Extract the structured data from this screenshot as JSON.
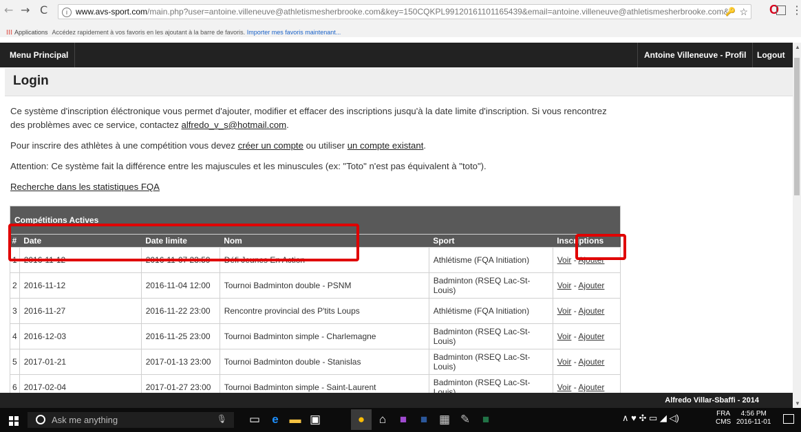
{
  "browser": {
    "url_host": "www.avs-sport.com",
    "url_rest": "/main.php?user=antoine.villeneuve@athletismesherbrooke.com&key=150CQKPL99120161101165439&email=antoine.villeneuve@athletismesherbrooke.com&",
    "bookmarks_apps": "Applications",
    "bookmarks_hint": "Accédez rapidement à vos favoris en les ajoutant à la barre de favoris.",
    "bookmarks_import": "Importer mes favoris maintenant..."
  },
  "nav": {
    "menu": "Menu Principal",
    "profile": "Antoine Villeneuve - Profil",
    "logout": "Logout"
  },
  "page": {
    "title": "Login",
    "p1_text": "Ce système d'inscription éléctronique vous permet d'ajouter, modifier et effacer des inscriptions jusqu'à la date limite d'inscription. Si vous rencontrez des problèmes avec ce service, contactez ",
    "p1_email": "alfredo_v_s@hotmail.com",
    "p1_end": ".",
    "p2_text": "Pour inscrire des athlètes à une compétition vous devez ",
    "p2_link1": "créer un compte",
    "p2_mid": " ou utiliser ",
    "p2_link2": "un compte existant",
    "p2_end": ".",
    "p3": "Attention: Ce système fait la différence entre les majuscules et les minuscules (ex: \"Toto\" n'est pas équivalent à \"toto\").",
    "stats_link": "Recherche dans les statistiques FQA"
  },
  "table": {
    "caption": "Compétitions Actives",
    "headers": {
      "num": "#",
      "date": "Date",
      "deadline": "Date limite",
      "name": "Nom",
      "sport": "Sport",
      "inscriptions": "Inscriptions"
    },
    "voir": "Voir",
    "sep": " - ",
    "ajouter": "Ajouter",
    "rows": [
      {
        "num": "1",
        "date": "2016-11-12",
        "deadline": "2016-11-07 23:59",
        "name": "Défi Jeunes En Action",
        "sport": "Athlétisme (FQA Initiation)"
      },
      {
        "num": "2",
        "date": "2016-11-12",
        "deadline": "2016-11-04 12:00",
        "name": "Tournoi Badminton double - PSNM",
        "sport": "Badminton (RSEQ Lac-St-Louis)"
      },
      {
        "num": "3",
        "date": "2016-11-27",
        "deadline": "2016-11-22 23:00",
        "name": "Rencontre provincial des P'tits Loups",
        "sport": "Athlétisme (FQA Initiation)"
      },
      {
        "num": "4",
        "date": "2016-12-03",
        "deadline": "2016-11-25 23:00",
        "name": "Tournoi Badminton simple - Charlemagne",
        "sport": "Badminton (RSEQ Lac-St-Louis)"
      },
      {
        "num": "5",
        "date": "2017-01-21",
        "deadline": "2017-01-13 23:00",
        "name": "Tournoi Badminton double - Stanislas",
        "sport": "Badminton (RSEQ Lac-St-Louis)"
      },
      {
        "num": "6",
        "date": "2017-02-04",
        "deadline": "2017-01-27 23:00",
        "name": "Tournoi Badminton simple - Saint-Laurent",
        "sport": "Badminton (RSEQ Lac-St-Louis)"
      }
    ]
  },
  "footer": "Alfredo Villar-Sbaffi - 2014",
  "taskbar": {
    "search_placeholder": "Ask me anything",
    "lang_top": "FRA",
    "lang_bottom": "CMS",
    "time": "4:56 PM",
    "date": "2016-11-01"
  },
  "colors": {
    "highlight": "#e00000",
    "nav_bg": "#222222",
    "table_header": "#595959"
  }
}
